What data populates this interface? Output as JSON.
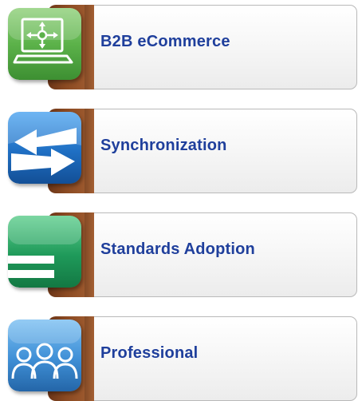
{
  "items": [
    {
      "label": "B2B eCommerce",
      "icon": "monitor-arrows-icon",
      "color": "#5cb24a"
    },
    {
      "label": "Synchronization",
      "icon": "sync-arrows-icon",
      "color": "#1f6fc3"
    },
    {
      "label": "Standards Adoption",
      "icon": "equals-icon",
      "color": "#1f9a5a"
    },
    {
      "label": "Professional",
      "icon": "people-icon",
      "color": "#3f8fd6"
    }
  ],
  "colors": {
    "label_text": "#1f3f9c",
    "tab_brown": "#8b4a22",
    "card_border": "#b9b9b9"
  }
}
